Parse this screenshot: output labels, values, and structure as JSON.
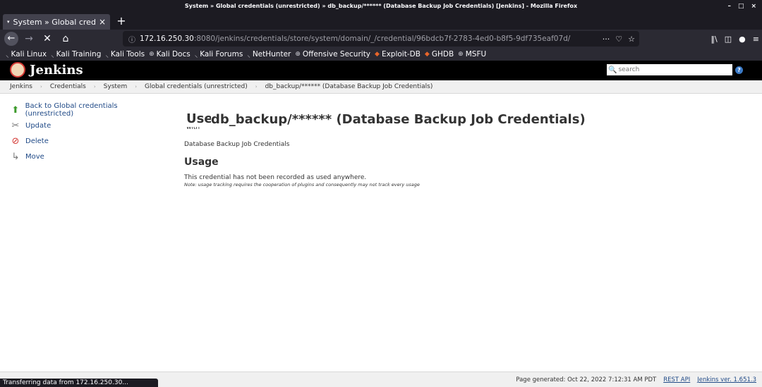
{
  "window": {
    "title": "System » Global credentials (unrestricted) » db_backup/****** (Database Backup Job Credentials) [Jenkins] - Mozilla Firefox"
  },
  "tab": {
    "title": "System » Global credenti",
    "close": "×",
    "new": "+"
  },
  "urlbar": {
    "host": "172.16.250.30",
    "rest": ":8080/jenkins/credentials/store/system/domain/_/credential/96bdcb7f-2783-4ed0-b8f5-9df735eaf07d/"
  },
  "bookmarks": [
    {
      "label": "Kali Linux",
      "icon": "kali-dragon-icon"
    },
    {
      "label": "Kali Training",
      "icon": "kali-dragon-icon"
    },
    {
      "label": "Kali Tools",
      "icon": "kali-dragon-icon"
    },
    {
      "label": "Kali Docs",
      "icon": "globe-icon"
    },
    {
      "label": "Kali Forums",
      "icon": "kali-dragon-icon"
    },
    {
      "label": "NetHunter",
      "icon": "kali-dragon-icon"
    },
    {
      "label": "Offensive Security",
      "icon": "globe-icon"
    },
    {
      "label": "Exploit-DB",
      "icon": "exploitdb-icon"
    },
    {
      "label": "GHDB",
      "icon": "exploitdb-icon"
    },
    {
      "label": "MSFU",
      "icon": "globe-icon"
    }
  ],
  "jenkins": {
    "logo_text": "Jenkins",
    "search_placeholder": "search",
    "help": "?"
  },
  "breadcrumbs": [
    "Jenkins",
    "Credentials",
    "System",
    "Global credentials (unrestricted)",
    "db_backup/****** (Database Backup Job Credentials)"
  ],
  "sidepanel": {
    "items": [
      {
        "label": "Back to Global credentials (unrestricted)",
        "icon": "up-arrow-icon"
      },
      {
        "label": "Update",
        "icon": "wrench-icon"
      },
      {
        "label": "Delete",
        "icon": "no-entry-icon"
      },
      {
        "label": "Move",
        "icon": "move-icon"
      }
    ]
  },
  "main": {
    "title_ghost": "Use",
    "title_ghost_below": "with",
    "title": "db_backup/****** (Database Backup Job Credentials)",
    "description": "Database Backup Job Credentials",
    "usage_heading": "Usage",
    "usage_text": "This credential has not been recorded as used anywhere.",
    "usage_note": "Note: usage tracking requires the cooperation of plugins and consequently may not track every usage"
  },
  "footer": {
    "generated": "Page generated: Oct 22, 2022 7:12:31 AM PDT",
    "rest_api": "REST API",
    "version": "Jenkins ver. 1.651.3"
  },
  "status": {
    "text": "Transferring data from 172.16.250.30..."
  }
}
